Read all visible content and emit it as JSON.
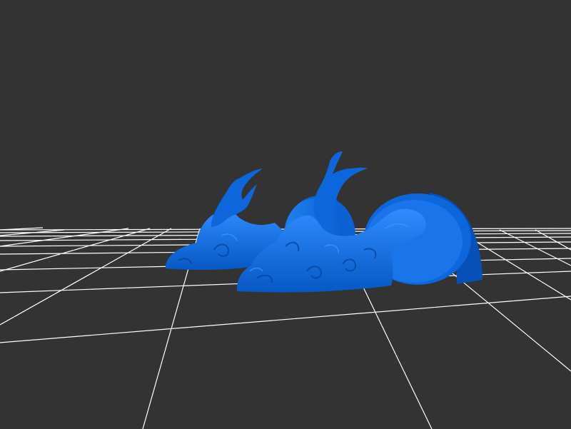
{
  "viewport": {
    "background_color": "#333333",
    "grid_color": "#ffffff",
    "model_color": "#0a6ee6",
    "model_shadow_color": "#0746a8",
    "model_highlight_color": "#3a9cff",
    "objects": [
      "sculpted-figure",
      "round-base-back",
      "round-base-front"
    ]
  }
}
